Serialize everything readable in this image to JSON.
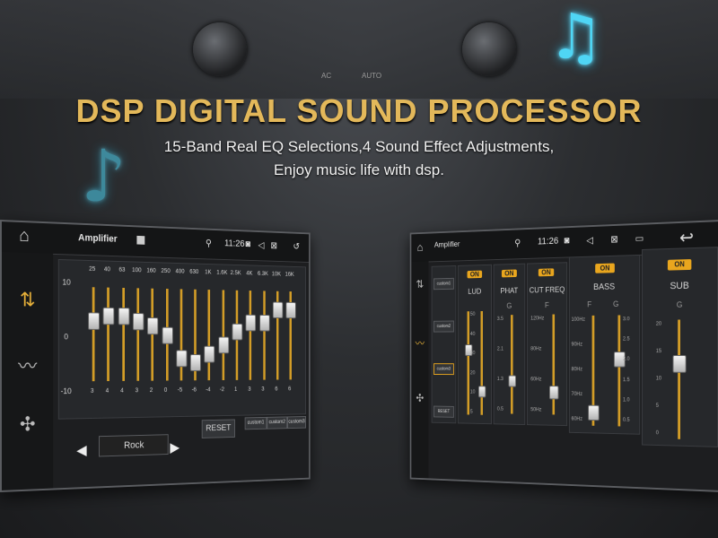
{
  "headline": "DSP DIGITAL SOUND PROCESSOR",
  "subline1": "15-Band Real EQ Selections,4 Sound Effect Adjustments,",
  "subline2": "Enjoy music life with dsp.",
  "dash": {
    "ac": "AC",
    "auto": "AUTO"
  },
  "accent": "#e3b85a",
  "slider_color": "#d39d27",
  "left_screen": {
    "title": "Amplifier",
    "time": "11:26",
    "y_axis": [
      "10",
      "0",
      "-10"
    ],
    "bands": [
      {
        "freq": "25",
        "val": "3",
        "level": 0.65
      },
      {
        "freq": "40",
        "val": "4",
        "level": 0.7
      },
      {
        "freq": "63",
        "val": "4",
        "level": 0.7
      },
      {
        "freq": "100",
        "val": "3",
        "level": 0.65
      },
      {
        "freq": "160",
        "val": "2",
        "level": 0.6
      },
      {
        "freq": "250",
        "val": "0",
        "level": 0.5
      },
      {
        "freq": "400",
        "val": "-5",
        "level": 0.25
      },
      {
        "freq": "630",
        "val": "-6",
        "level": 0.2
      },
      {
        "freq": "1K",
        "val": "-4",
        "level": 0.3
      },
      {
        "freq": "1.6K",
        "val": "-2",
        "level": 0.4
      },
      {
        "freq": "2.5K",
        "val": "1",
        "level": 0.55
      },
      {
        "freq": "4K",
        "val": "3",
        "level": 0.65
      },
      {
        "freq": "6.3K",
        "val": "3",
        "level": 0.65
      },
      {
        "freq": "10K",
        "val": "6",
        "level": 0.8
      },
      {
        "freq": "16K",
        "val": "6",
        "level": 0.8
      }
    ],
    "preset": "Rock",
    "reset": "RESET",
    "custom": [
      "custom1",
      "custom2",
      "custom3"
    ]
  },
  "right_screen": {
    "title": "Amplifier",
    "time": "11:26",
    "presets": [
      "custom1",
      "custom2",
      "custom3"
    ],
    "reset": "RESET",
    "on_label": "ON",
    "loud": {
      "label": "LUD",
      "ticks": [
        "50",
        "40",
        "30",
        "20",
        "10",
        "5"
      ]
    },
    "phat": {
      "label": "PHAT",
      "sub": "G",
      "ticks": [
        "3.5",
        "2.1",
        "1.3",
        "0.5"
      ]
    },
    "cut": {
      "label": "CUT FREQ",
      "sub": "F",
      "ticks": [
        "120Hz",
        "80Hz",
        "60Hz",
        "50Hz"
      ]
    },
    "bass": {
      "label": "BASS",
      "sub_f": "F",
      "sub_g": "G",
      "f_ticks": [
        "100Hz",
        "90Hz",
        "80Hz",
        "70Hz",
        "60Hz"
      ],
      "g_ticks": [
        "3.0",
        "2.5",
        "2.0",
        "1.5",
        "1.0",
        "0.5"
      ]
    },
    "sub": {
      "label": "SUB",
      "sub": "G",
      "ticks": [
        "20",
        "15",
        "10",
        "5",
        "0"
      ]
    }
  }
}
